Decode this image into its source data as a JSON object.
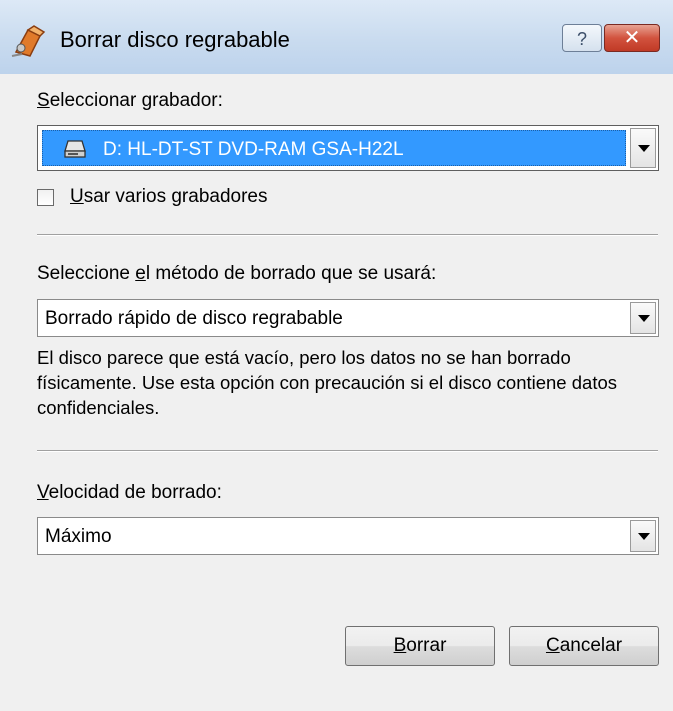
{
  "window": {
    "title": "Borrar disco regrabable",
    "help_glyph": "?",
    "close_glyph": "✕",
    "title_icon": "eraser-icon"
  },
  "recorder": {
    "label_mnemonic": "S",
    "label_rest": "eleccionar grabador:",
    "selected": "D: HL-DT-ST DVD-RAM GSA-H22L",
    "selected_icon": "drive-icon"
  },
  "multi_recorder": {
    "label_mnemonic": "U",
    "label_rest": "sar varios grabadores",
    "checked": false
  },
  "method": {
    "label_before": "Seleccione ",
    "label_mnemonic": "e",
    "label_after": "l método de borrado que se usará:",
    "selected": "Borrado rápido de disco regrabable",
    "description": "El disco parece que está vacío, pero los datos no se han borrado físicamente. Use esta opción con precaución si el disco contiene datos confidenciales."
  },
  "speed": {
    "label_mnemonic": "V",
    "label_rest": "elocidad de borrado:",
    "selected": "Máximo"
  },
  "buttons": {
    "erase_mnemonic": "B",
    "erase_rest": "orrar",
    "cancel_mnemonic": "C",
    "cancel_rest": "ancelar"
  }
}
